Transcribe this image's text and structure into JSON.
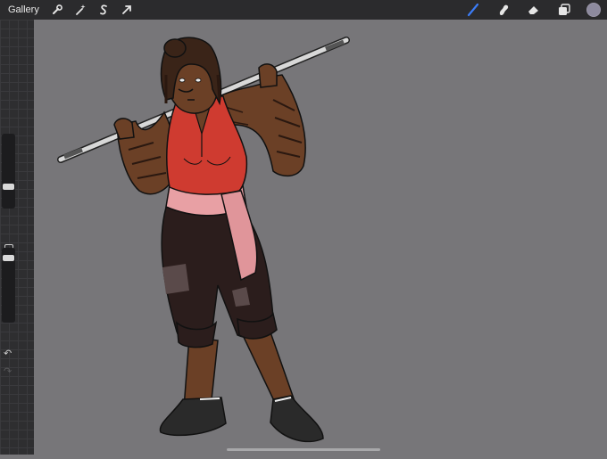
{
  "topbar": {
    "gallery_label": "Gallery",
    "left_tools": [
      "wrench-icon",
      "magic-wand-icon",
      "selection-s-icon",
      "transform-arrow-icon"
    ],
    "right_tools": [
      "brush-icon",
      "smudge-icon",
      "eraser-icon",
      "layers-icon"
    ],
    "active_tool": "brush-icon",
    "active_tool_color": "#3b7cf7",
    "current_color": "#8d8a9e"
  },
  "sidebar": {
    "brush_size_level": 0.28,
    "opacity_level": 0.92
  },
  "canvas": {
    "background": "#777679",
    "artwork": "character-illustration"
  }
}
